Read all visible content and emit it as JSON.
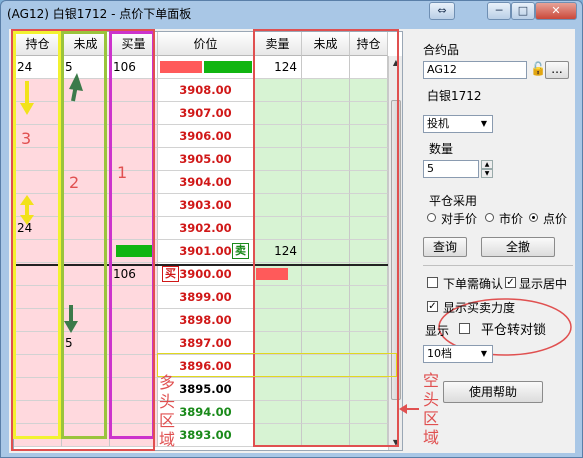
{
  "window": {
    "title": "(AG12) 白银1712 - 点价下单面板",
    "buttons": {
      "swap": "⇔",
      "minimize": "─",
      "restore": "□",
      "close": "✕"
    }
  },
  "table": {
    "headers": {
      "hold_buy": "持仓",
      "pending_buy": "未成",
      "buy_qty": "买量",
      "price": "价位",
      "sell_qty": "卖量",
      "pending_sell": "未成",
      "hold_sell": "持仓"
    },
    "top": {
      "hold_buy": "24",
      "pending_buy": "5",
      "buy_qty": "106",
      "sell_qty": "124"
    },
    "prices": [
      "3908.00",
      "3907.00",
      "3906.00",
      "3905.00",
      "3904.00",
      "3903.00",
      "3902.00",
      "3901.00",
      "3900.00",
      "3899.00",
      "3898.00",
      "3897.00",
      "3896.00",
      "3895.00",
      "3894.00",
      "3893.00"
    ],
    "side_values": {
      "hold_3902": "24",
      "sell_3901": "124",
      "buy_3900": "106",
      "pending_3897": "5"
    },
    "tags": {
      "sell": "卖",
      "buy": "买"
    }
  },
  "annotations": {
    "n1": "1",
    "n2": "2",
    "n3": "3",
    "long_zone": "多\n头\n区\n域",
    "short_zone": "空\n头\n区\n域"
  },
  "panel": {
    "contract_label": "合约品",
    "contract_value": "AG12",
    "browse_label": "...",
    "contract_name": "白银1712",
    "hedge_value": "投机",
    "qty_label": "数量",
    "qty_value": "5",
    "close_label": "平仓采用",
    "radio_opponent": "对手价",
    "radio_market": "市价",
    "radio_point": "点价",
    "query_button": "查询",
    "cancel_all_button": "全撤",
    "confirm_check": "下单需确认",
    "center_check": "显示居中",
    "strength_check": "显示买卖力度",
    "display_label": "显示",
    "lock_check": "平仓转对锁",
    "depth_value": "10档",
    "help_button": "使用帮助"
  },
  "colors": {
    "buy_bar": "#ff5a5a",
    "sell_bar": "#11b511",
    "pink_zone": "#ffd9de",
    "green_zone": "#d7f3d3"
  }
}
